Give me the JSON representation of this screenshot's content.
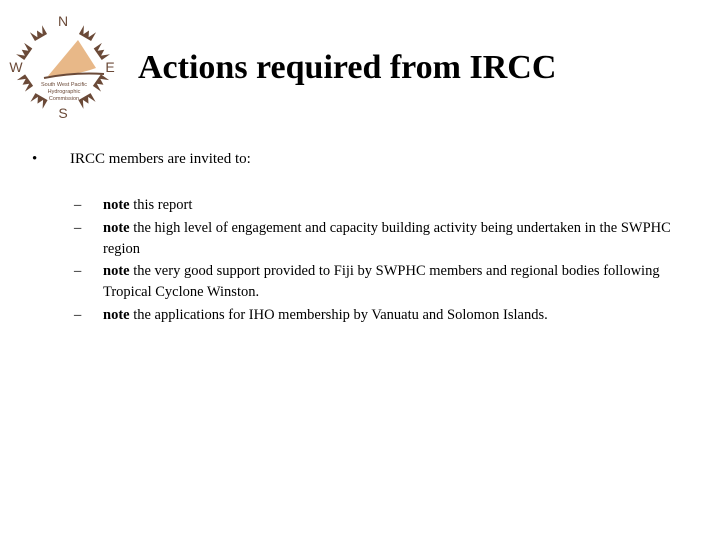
{
  "logo": {
    "name": "South West Pacific Hydrographic Commission",
    "compass": {
      "n": "N",
      "s": "S",
      "e": "E",
      "w": "W"
    },
    "text_lines": [
      "South West Pacific",
      "Hydrographic",
      "Commission"
    ],
    "colors": {
      "brown": "#6b4a38",
      "sail": "#e8b888"
    }
  },
  "slide": {
    "title": "Actions required from IRCC",
    "bullet_symbol": "•",
    "intro": "IRCC members are invited to:",
    "dash_symbol": "–",
    "items": [
      {
        "keyword": "note",
        "text": " this report"
      },
      {
        "keyword": "note",
        "text": " the high level of engagement and capacity building activity being undertaken in the SWPHC region"
      },
      {
        "keyword": "note",
        "text": " the very good support provided to Fiji by SWPHC members and regional bodies following Tropical Cyclone Winston."
      },
      {
        "keyword": "note",
        "text": " the applications for IHO membership by Vanuatu and Solomon Islands."
      }
    ]
  }
}
